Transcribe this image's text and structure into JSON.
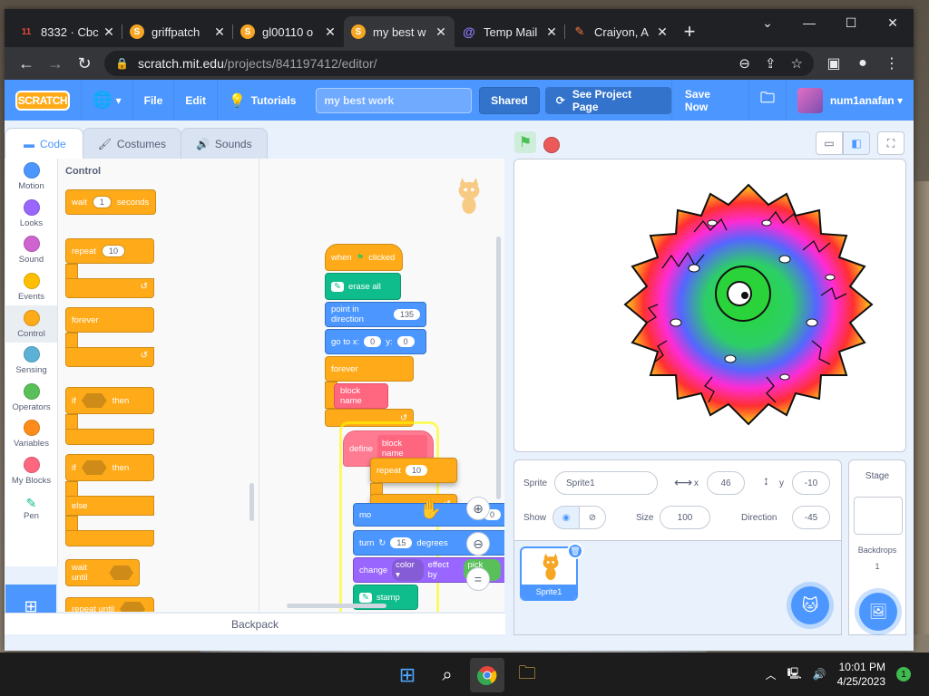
{
  "browser": {
    "tabs": [
      {
        "title": "8332 · Cbc",
        "favicon": "cbc-icon",
        "favicon_text": "11",
        "favicon_color": "#e8453c"
      },
      {
        "title": "griffpatch",
        "favicon": "scratch-s-icon",
        "favicon_color": "#f6a623"
      },
      {
        "title": "gl00110 o",
        "favicon": "scratch-s-icon",
        "favicon_color": "#f6a623"
      },
      {
        "title": "my best w",
        "favicon": "scratch-s-icon",
        "favicon_color": "#f6a623",
        "active": true
      },
      {
        "title": "Temp Mail",
        "favicon": "at-icon",
        "favicon_color": "#8a7dff"
      },
      {
        "title": "Craiyon, A",
        "favicon": "pencil-icon",
        "favicon_color": "#ff7b3b"
      }
    ],
    "url_host": "scratch.mit.edu",
    "url_path": "/projects/841197412/editor/"
  },
  "menubar": {
    "logo": "SCRATCH",
    "file": "File",
    "edit": "Edit",
    "tutorials": "Tutorials",
    "project_title": "my best work",
    "shared": "Shared",
    "see_project": "See Project Page",
    "save_now": "Save Now",
    "username": "num1anafan"
  },
  "editor_tabs": {
    "code": "Code",
    "costumes": "Costumes",
    "sounds": "Sounds"
  },
  "categories": [
    {
      "label": "Motion",
      "color": "#4c97ff"
    },
    {
      "label": "Looks",
      "color": "#9966ff"
    },
    {
      "label": "Sound",
      "color": "#cf63cf"
    },
    {
      "label": "Events",
      "color": "#ffbf00"
    },
    {
      "label": "Control",
      "color": "#ffab19",
      "selected": true
    },
    {
      "label": "Sensing",
      "color": "#5cb1d6"
    },
    {
      "label": "Operators",
      "color": "#59c059"
    },
    {
      "label": "Variables",
      "color": "#ff8c1a"
    },
    {
      "label": "My Blocks",
      "color": "#ff6680"
    },
    {
      "label": "Pen",
      "color": "#0fbd8c"
    }
  ],
  "palette": {
    "heading": "Control",
    "wait": "wait",
    "wait_val": "1",
    "seconds": "seconds",
    "repeat": "repeat",
    "repeat_val": "10",
    "forever": "forever",
    "if": "if",
    "then": "then",
    "else": "else",
    "wait_until": "wait until",
    "repeat_until": "repeat until"
  },
  "script": {
    "when": "when",
    "clicked": "clicked",
    "erase_all": "erase all",
    "point_dir": "point in direction",
    "point_val": "135",
    "goto": "go to x:",
    "goto_x": "0",
    "y_label": "y:",
    "goto_y": "0",
    "forever": "forever",
    "block_name": "block name",
    "define": "define",
    "define_name": "block name",
    "repeat": "repeat",
    "repeat_val": "10",
    "move": "mo",
    "move_val": "0",
    "turn": "turn",
    "turn_val": "15",
    "degrees": "degrees",
    "change": "change",
    "color": "color ▾",
    "effect_by": "effect by",
    "pick_random": "pick ran",
    "stamp": "stamp"
  },
  "backpack": "Backpack",
  "sprite_info": {
    "sprite_label": "Sprite",
    "sprite_name": "Sprite1",
    "x_label": "x",
    "x_val": "46",
    "y_label": "y",
    "y_val": "-10",
    "show_label": "Show",
    "size_label": "Size",
    "size_val": "100",
    "direction_label": "Direction",
    "direction_val": "-45"
  },
  "sprite_list": [
    {
      "name": "Sprite1"
    }
  ],
  "stage_panel": {
    "title": "Stage",
    "backdrops_label": "Backdrops",
    "backdrops_count": "1"
  },
  "taskbar": {
    "time": "10:01 PM",
    "date": "4/25/2023",
    "notifications": "1"
  }
}
